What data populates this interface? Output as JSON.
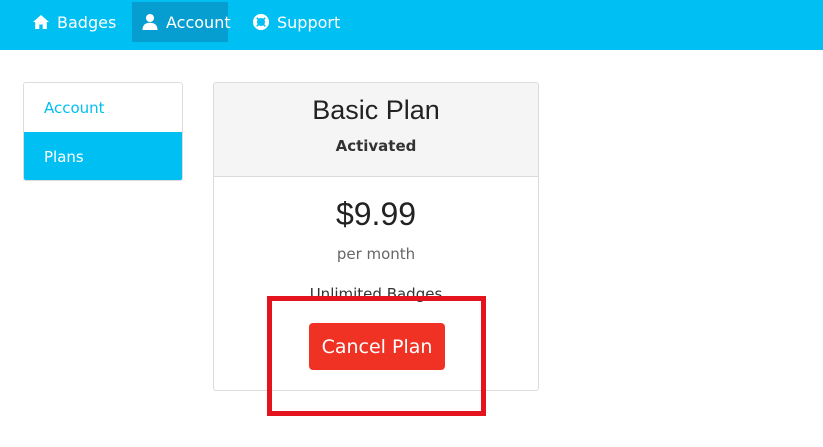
{
  "nav": {
    "items": [
      {
        "label": "Badges",
        "icon": "home-icon"
      },
      {
        "label": "Account",
        "icon": "user-icon",
        "active": true
      },
      {
        "label": "Support",
        "icon": "lifebuoy-icon"
      }
    ]
  },
  "sidebar": {
    "items": [
      {
        "label": "Account"
      },
      {
        "label": "Plans",
        "active": true
      }
    ]
  },
  "plan": {
    "title": "Basic Plan",
    "status": "Activated",
    "price": "$9.99",
    "period": "per month",
    "feature": "Unlimited Badges",
    "cancel_label": "Cancel Plan"
  },
  "colors": {
    "nav_bg": "#00bff3",
    "nav_active_bg": "#069ed1",
    "cancel_button": "#ef3224",
    "highlight_border": "#e3141e"
  }
}
